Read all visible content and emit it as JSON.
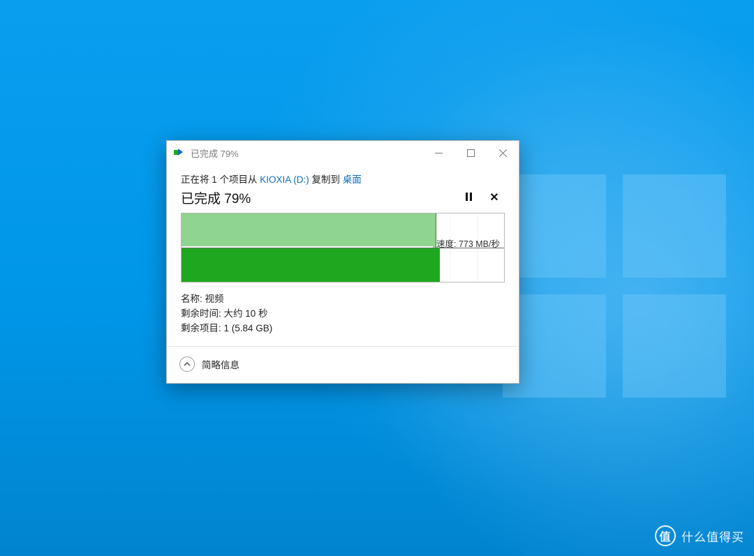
{
  "window": {
    "title": "已完成 79%"
  },
  "transfer": {
    "copy_prefix": "正在将 1 个项目从 ",
    "source": "KIOXIA (D:)",
    "copy_mid": " 复制到 ",
    "dest": "桌面",
    "progress_label": "已完成 79%",
    "progress_percent": 79,
    "speed_label": "速度: 773 MB/秒",
    "speed_fill_percent": 80
  },
  "details": {
    "name_label": "名称: ",
    "name_value": "视频",
    "time_label": "剩余时间: ",
    "time_value": "大约 10 秒",
    "remain_label": "剩余项目: ",
    "remain_value": "1 (5.84 GB)"
  },
  "footer": {
    "toggle_label": "简略信息"
  },
  "watermark": {
    "badge": "值",
    "text": "什么值得买"
  }
}
